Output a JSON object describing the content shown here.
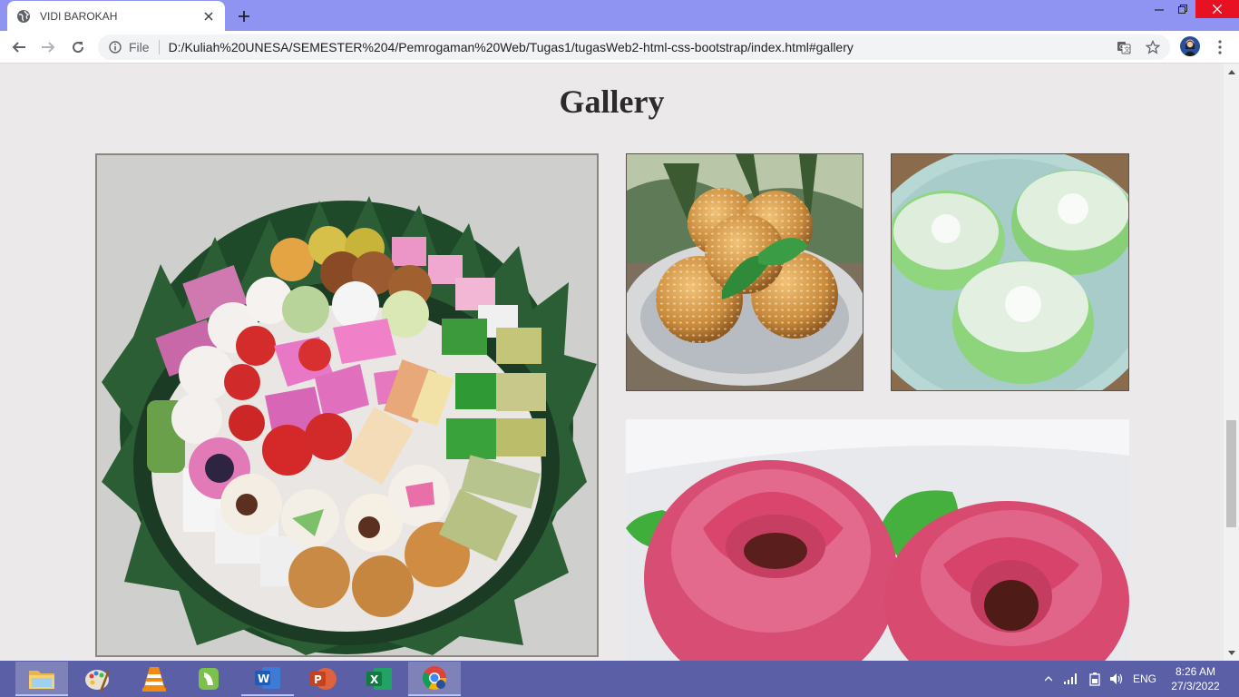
{
  "browser": {
    "tab_title": "VIDI BAROKAH",
    "url_scheme_label": "File",
    "url": "D:/Kuliah%20UNESA/SEMESTER%204/Pemrogaman%20Web/Tugas1/tugasWeb2-html-css-bootstrap/index.html#gallery",
    "icons": [
      "globe-icon",
      "close-icon",
      "plus-icon",
      "minimize-icon",
      "restore-icon",
      "close-icon",
      "back-arrow-icon",
      "forward-arrow-icon",
      "reload-icon",
      "info-icon",
      "translate-icon",
      "star-icon",
      "avatar",
      "kebab-menu-icon"
    ],
    "colors": {
      "tab_strip": "#8f93f2",
      "close_button": "#e81123"
    }
  },
  "page": {
    "section_title": "Gallery",
    "background": "#ebe9ea",
    "photos": [
      "tumpeng-kue-photo",
      "onde-onde-photo",
      "putu-ayu-photo",
      "kue-mawar-photo"
    ]
  },
  "taskbar": {
    "apps": [
      "file-explorer-icon",
      "paint-icon",
      "vlc-icon",
      "camtasia-icon",
      "word-icon",
      "powerpoint-icon",
      "excel-icon",
      "chrome-icon"
    ],
    "language": "ENG",
    "time": "8:26 AM",
    "date": "27/3/2022",
    "colors": {
      "background": "#5b5fa6"
    }
  }
}
